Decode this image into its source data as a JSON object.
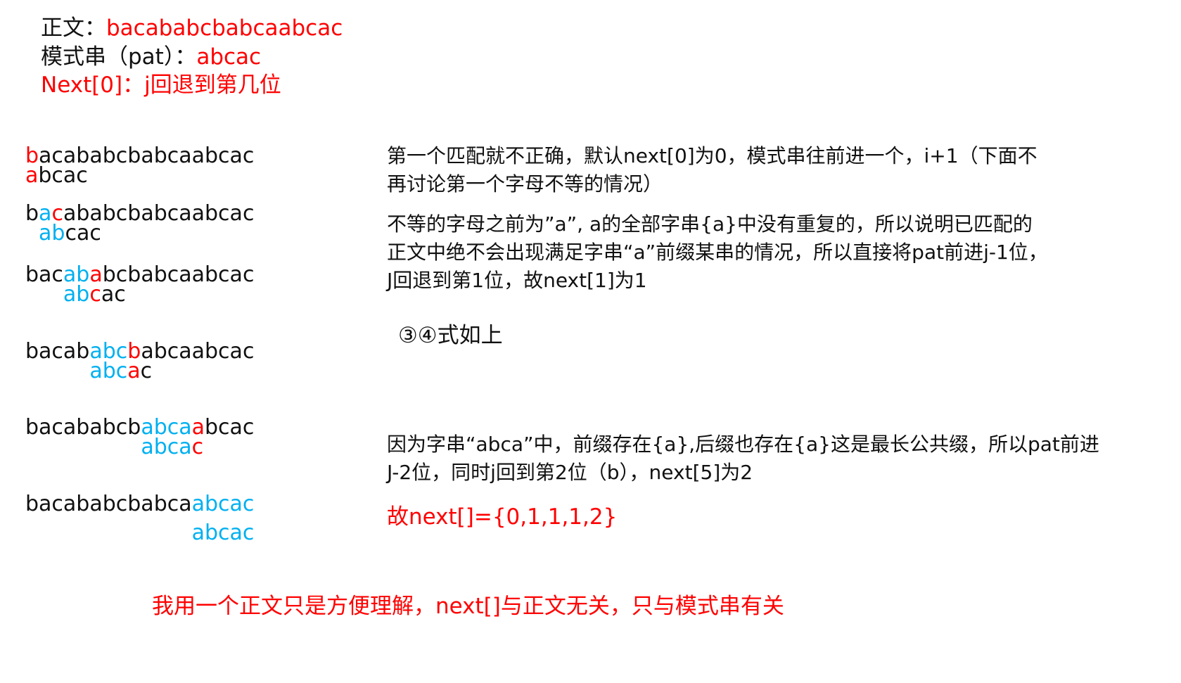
{
  "header": {
    "text_label": "正文：",
    "text_value": "bacababcbabcaabcac",
    "pattern_label": "模式串（pat）：",
    "pattern_value": "abcac",
    "next_note": "Next[0]：j回退到第几位"
  },
  "alignments": [
    {
      "text": [
        {
          "t": "b",
          "c": "red"
        },
        {
          "t": "acababcbabcaabcac",
          "c": "black"
        }
      ],
      "pattern": [
        {
          "t": "a",
          "c": "red"
        },
        {
          "t": "bcac",
          "c": "black"
        }
      ]
    },
    {
      "text": [
        {
          "t": "b",
          "c": "black"
        },
        {
          "t": "a",
          "c": "blue"
        },
        {
          "t": "c",
          "c": "red"
        },
        {
          "t": "ababcbabcaabcac",
          "c": "black"
        }
      ],
      "pattern": [
        {
          "t": "ab",
          "c": "blue"
        },
        {
          "t": "cac",
          "c": "black"
        }
      ]
    },
    {
      "text": [
        {
          "t": "bac",
          "c": "black"
        },
        {
          "t": "ab",
          "c": "blue"
        },
        {
          "t": "a",
          "c": "red"
        },
        {
          "t": "bcbabcaabcac",
          "c": "black"
        }
      ],
      "pattern": [
        {
          "t": "ab",
          "c": "blue"
        },
        {
          "t": "c",
          "c": "red"
        },
        {
          "t": "ac",
          "c": "black"
        }
      ]
    },
    {
      "text": [
        {
          "t": "bacab",
          "c": "black"
        },
        {
          "t": "abc",
          "c": "blue"
        },
        {
          "t": "b",
          "c": "red"
        },
        {
          "t": "abcaabcac",
          "c": "black"
        }
      ],
      "pattern": [
        {
          "t": "abc",
          "c": "blue"
        },
        {
          "t": "a",
          "c": "red"
        },
        {
          "t": "c",
          "c": "black"
        }
      ]
    },
    {
      "text": [
        {
          "t": "bacababcb",
          "c": "black"
        },
        {
          "t": "abca",
          "c": "blue"
        },
        {
          "t": "a",
          "c": "red"
        },
        {
          "t": "bcac",
          "c": "black"
        }
      ],
      "pattern": [
        {
          "t": "abca",
          "c": "blue"
        },
        {
          "t": "c",
          "c": "red"
        }
      ]
    },
    {
      "text": [
        {
          "t": "bacababcbabca",
          "c": "black"
        },
        {
          "t": "abcac",
          "c": "blue"
        }
      ],
      "pattern": [
        {
          "t": "abcac",
          "c": "blue"
        }
      ]
    }
  ],
  "explanations": {
    "step1": [
      "第一个匹配就不正确，默认next[0]为0，模式串往前进一个，i+1（下面不",
      "再讨论第一个字母不等的情况）"
    ],
    "step2": [
      "不等的字母之前为”a”, a的全部字串{a}中没有重复的，所以说明已匹配的",
      "正文中绝不会出现满足字串“a”前缀某串的情况，所以直接将pat前进j-1位，",
      "J回退到第1位，故next[1]为1"
    ],
    "step34": "③④式如上",
    "step5": [
      "因为字串“abca”中，前缀存在{a},后缀也存在{a}这是最长公共缀，所以pat前进",
      "J-2位，同时j回到第2位（b），next[5]为2"
    ],
    "result": "故next[]={0,1,1,1,2}"
  },
  "footer_note": "我用一个正文只是方便理解，next[]与正文无关，只与模式串有关",
  "colors": {
    "red": "#ff0000",
    "blue": "#00b0f0",
    "black": "#111111"
  }
}
